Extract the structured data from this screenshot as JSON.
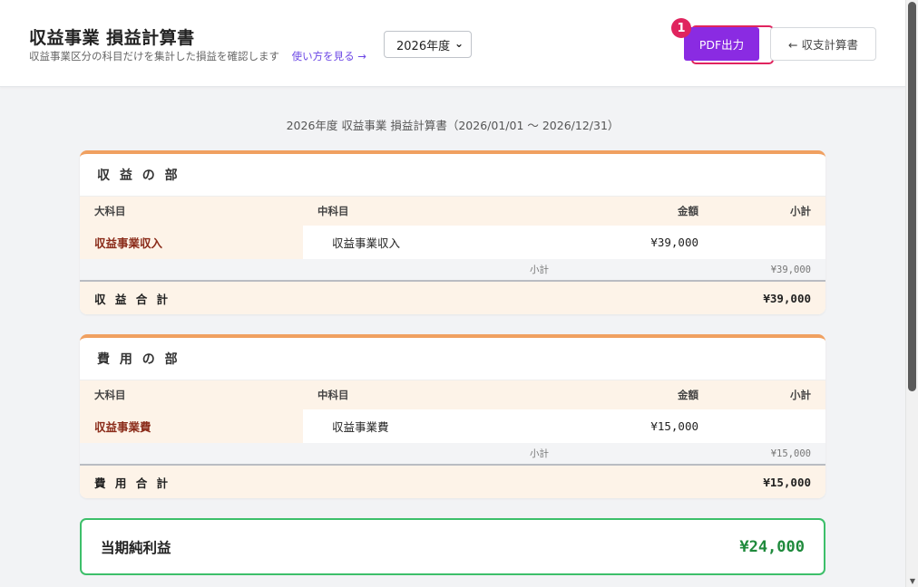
{
  "header": {
    "title": "収益事業 損益計算書",
    "subtitle": "収益事業区分の科目だけを集計した損益を確認します",
    "help_link": "使い方を見る →",
    "year_selected": "2026年度",
    "pdf_button": "PDF出力",
    "badge": "1",
    "back_button": "← 収支計算書"
  },
  "period_label": "2026年度 収益事業 損益計算書（2026/01/01 〜 2026/12/31）",
  "columns": {
    "major": "大科目",
    "middle": "中科目",
    "amount": "金額",
    "subtotal": "小計"
  },
  "revenue": {
    "title": "収 益 の 部",
    "items": [
      {
        "major": "収益事業収入",
        "middle": "収益事業収入",
        "amount": "¥39,000"
      }
    ],
    "subtotal_label": "小計",
    "subtotal_value": "¥39,000",
    "total_label": "収 益 合 計",
    "total_value": "¥39,000"
  },
  "expense": {
    "title": "費 用 の 部",
    "items": [
      {
        "major": "収益事業費",
        "middle": "収益事業費",
        "amount": "¥15,000"
      }
    ],
    "subtotal_label": "小計",
    "subtotal_value": "¥15,000",
    "total_label": "費 用 合 計",
    "total_value": "¥15,000"
  },
  "net_income": {
    "label": "当期純利益",
    "value": "¥24,000"
  },
  "colors": {
    "accent_purple": "#8a2be2",
    "highlight_red": "#e0245e",
    "section_orange": "#f0a060",
    "net_green": "#1f8a3c",
    "net_border": "#3dbf6a",
    "category_brown": "#8b2c1a"
  }
}
